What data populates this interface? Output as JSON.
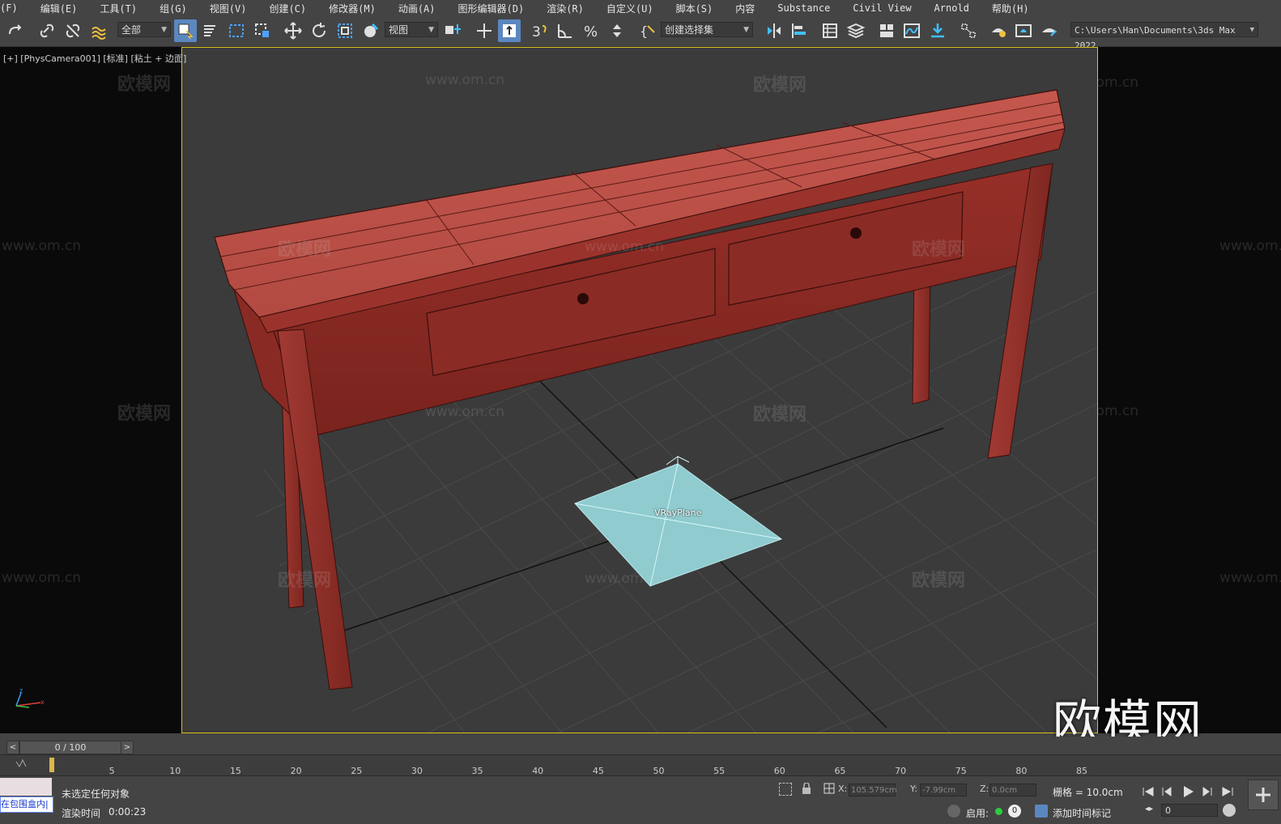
{
  "menu": [
    "(F)",
    "编辑(E)",
    "工具(T)",
    "组(G)",
    "视图(V)",
    "创建(C)",
    "修改器(M)",
    "动画(A)",
    "图形编辑器(D)",
    "渲染(R)",
    "自定义(U)",
    "脚本(S)",
    "内容",
    "Substance",
    "Civil View",
    "Arnold",
    "帮助(H)"
  ],
  "toolbar": {
    "filter_value": "全部",
    "ref_coord_value": "视图",
    "selection_set_placeholder": "创建选择集",
    "path_value": "C:\\Users\\Han\\Documents\\3ds Max 2022"
  },
  "viewport": {
    "label": "[+] [PhysCamera001] [标准] [粘土 + 边面]",
    "object_label": "VRayPlane",
    "watermark_text": "欧模网",
    "watermark_url": "www.om.cn",
    "big_watermark": "欧模网",
    "colors": {
      "table": "#b0463e",
      "plane": "#8fcbcf",
      "frame": "#d8c21b"
    }
  },
  "timeline": {
    "frame_display": "0 / 100",
    "ticks": [
      "5",
      "10",
      "15",
      "20",
      "25",
      "30",
      "35",
      "40",
      "45",
      "50",
      "55",
      "60",
      "65",
      "70",
      "75",
      "80",
      "85"
    ]
  },
  "status": {
    "selection_msg": "未选定任何对象",
    "render_time_label": "渲染时间",
    "render_time_value": "0:00:23",
    "left_box_text": "在包围盒内|",
    "x_label": "X:",
    "x_value": "105.579cm",
    "y_label": "Y:",
    "y_value": "-7.99cm",
    "z_label": "Z:",
    "z_value": "0.0cm",
    "grid_label": "栅格 = 10.0cm",
    "enable_label": "启用:",
    "enable_count": "0",
    "add_time_tag": "添加时间标记",
    "current_frame": "0"
  }
}
